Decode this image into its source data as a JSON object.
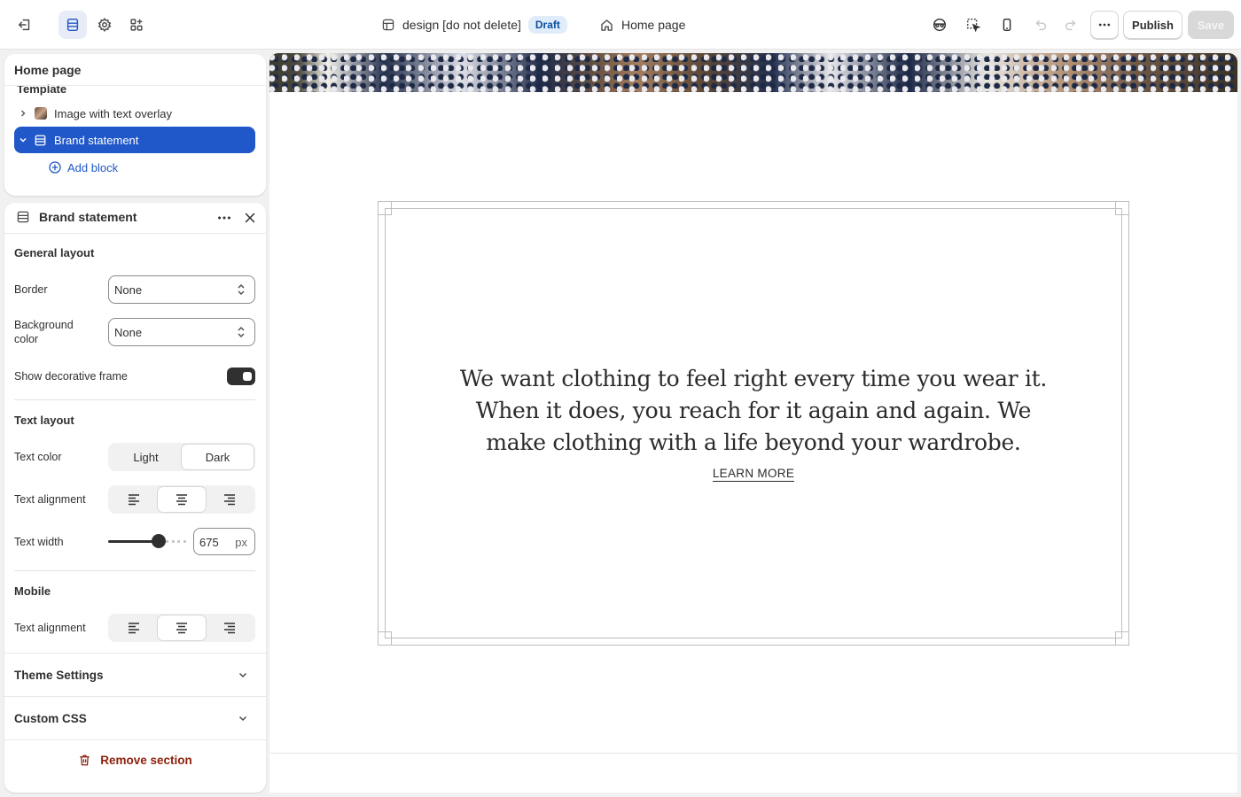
{
  "topbar": {
    "theme_name": "design [do not delete]",
    "status_badge": "Draft",
    "page_selector": "Home page",
    "publish_label": "Publish",
    "save_label": "Save"
  },
  "tree": {
    "title": "Home page",
    "group_label": "Template",
    "items": [
      {
        "label": "Image with text overlay"
      },
      {
        "label": "Brand statement"
      }
    ],
    "add_block_label": "Add block"
  },
  "settings": {
    "title": "Brand statement",
    "general_layout": {
      "heading": "General layout",
      "border_label": "Border",
      "border_value": "None",
      "background_label": "Background color",
      "background_value": "None",
      "frame_label": "Show decorative frame",
      "frame_on": true
    },
    "text_layout": {
      "heading": "Text layout",
      "color_label": "Text color",
      "color_options": [
        "Light",
        "Dark"
      ],
      "color_selected": "Dark",
      "alignment_label": "Text alignment",
      "alignment_selected": "center",
      "width_label": "Text width",
      "width_value": "675",
      "width_unit": "px",
      "width_fraction": 0.65
    },
    "mobile": {
      "heading": "Mobile",
      "alignment_label": "Text alignment",
      "alignment_selected": "center"
    },
    "theme_settings_label": "Theme Settings",
    "custom_css_label": "Custom CSS",
    "remove_label": "Remove section"
  },
  "preview": {
    "quote": "We want clothing to feel right every time you wear it. When it does, you reach for it again and again. We make clothing with a life beyond your wardrobe.",
    "link_label": "LEARN MORE"
  },
  "colors": {
    "accent": "#2057c9",
    "danger": "#8e1f0b",
    "badge_bg": "#e0ecfa"
  },
  "icons": [
    "exit-icon",
    "sections-icon",
    "gear-icon",
    "apps-icon",
    "theme-icon",
    "home-icon",
    "inspector-icon",
    "select-icon",
    "mobile-icon",
    "undo-icon",
    "redo-icon",
    "more-icon",
    "chevron-right-icon",
    "chevron-down-icon",
    "section-icon",
    "plus-circle-icon",
    "close-icon",
    "select-arrows-icon",
    "align-left-icon",
    "align-center-icon",
    "align-right-icon",
    "trash-icon"
  ]
}
